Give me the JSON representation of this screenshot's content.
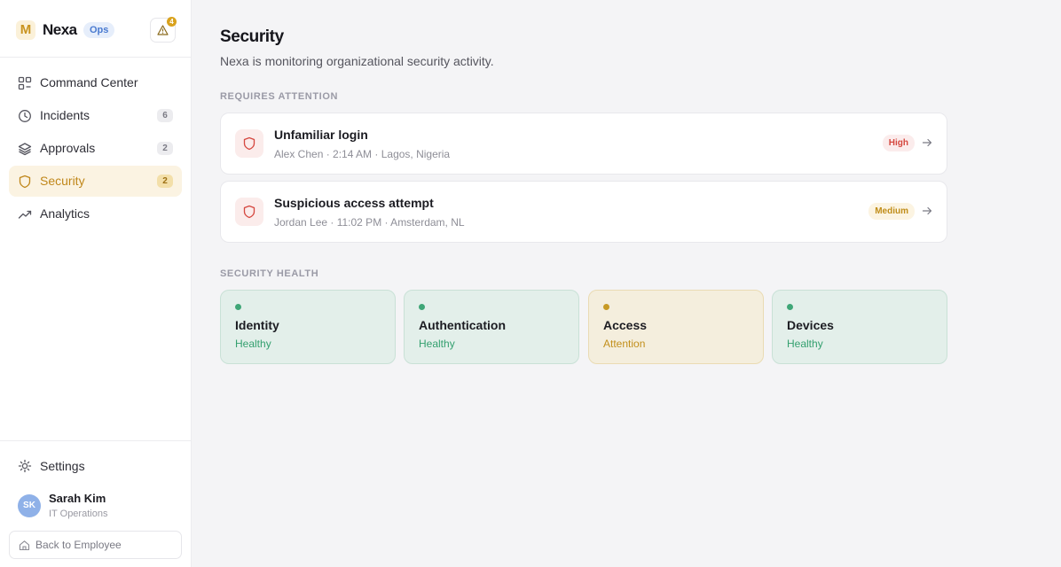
{
  "brand": {
    "logo_letter": "M",
    "name": "Nexa",
    "badge": "Ops",
    "alert_count": "4"
  },
  "sidebar": {
    "items": [
      {
        "label": "Command Center",
        "icon": "grid-icon",
        "count": ""
      },
      {
        "label": "Incidents",
        "icon": "clock-icon",
        "count": "6"
      },
      {
        "label": "Approvals",
        "icon": "layers-icon",
        "count": "2"
      },
      {
        "label": "Security",
        "icon": "shield-icon",
        "count": "2",
        "active": true
      },
      {
        "label": "Analytics",
        "icon": "trend-icon",
        "count": ""
      }
    ],
    "settings_label": "Settings",
    "user": {
      "initials": "SK",
      "name": "Sarah Kim",
      "role": "IT Operations"
    },
    "back_label": "Back to Employee"
  },
  "main": {
    "title": "Security",
    "subtitle": "Nexa is monitoring organizational security activity.",
    "attention_label": "REQUIRES ATTENTION",
    "alerts": [
      {
        "title": "Unfamiliar login",
        "meta": "Alex Chen · 2:14 AM · Lagos, Nigeria",
        "severity": "High"
      },
      {
        "title": "Suspicious access attempt",
        "meta": "Jordan Lee · 11:02 PM · Amsterdam, NL",
        "severity": "Medium"
      }
    ],
    "health_label": "SECURITY HEALTH",
    "health": [
      {
        "name": "Identity",
        "status": "Healthy"
      },
      {
        "name": "Authentication",
        "status": "Healthy"
      },
      {
        "name": "Access",
        "status": "Attention"
      },
      {
        "name": "Devices",
        "status": "Healthy"
      }
    ]
  },
  "colors": {
    "accent": "#c0871a",
    "healthy": "#34a06f",
    "attention": "#c28f1b",
    "high": "#d5473f"
  }
}
